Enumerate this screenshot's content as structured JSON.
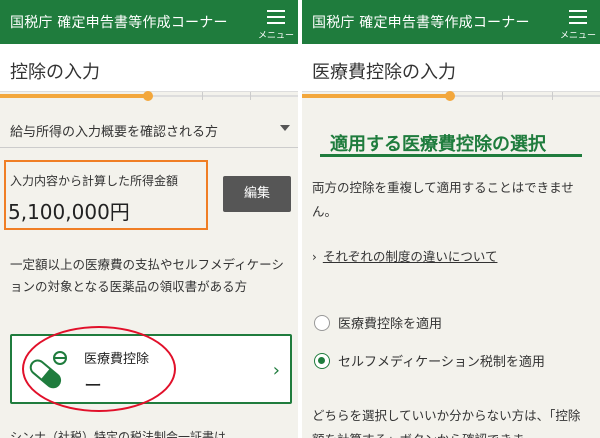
{
  "app": {
    "title": "国税庁 確定申告書等作成コーナー",
    "menu_label": "メニュー",
    "brand_color": "#1f7c3d",
    "accent_color": "#f3a73c"
  },
  "left": {
    "page_title": "控除の入力",
    "income_summary_select": "給与所得の入力概要を確認される方",
    "amount_label": "入力内容から計算した所得金額",
    "amount_value": "5,100,000円",
    "edit_button": "編集",
    "description": "一定額以上の医療費の支払やセルフメディケーションの対象となる医薬品の領収書がある方",
    "medical_card": {
      "title": "医療費控除",
      "value": "ー",
      "icon": "medicine-capsule-icon"
    },
    "highlight_color": "#e1102a",
    "bottom_text": "シンナ（社税）特定の税法制会一証書は…"
  },
  "right": {
    "page_title": "医療費控除の入力",
    "section_title": "適用する医療費控除の選択",
    "description": "両方の控除を重複して適用することはできません。",
    "link_text": "それぞれの制度の違いについて",
    "options": [
      {
        "label": "医療費控除を適用",
        "selected": false
      },
      {
        "label": "セルフメディケーション税制を適用",
        "selected": true
      }
    ],
    "bottom_text": "どちらを選択していいか分からない方は、「控除額を計算する」ボタンから確認できま"
  }
}
